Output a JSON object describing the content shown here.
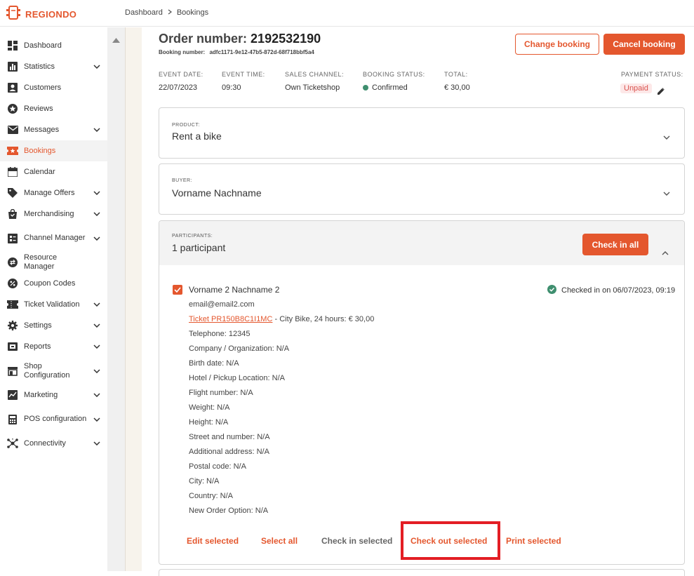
{
  "app": {
    "logo_text": "REGIONDO",
    "brand_color": "#e4572e"
  },
  "breadcrumb": {
    "items": [
      "Dashboard",
      "Bookings"
    ]
  },
  "sidebar": {
    "items": [
      {
        "label": "Dashboard",
        "icon": "dashboard-icon",
        "has_chevron": false
      },
      {
        "label": "Statistics",
        "icon": "chart-icon",
        "has_chevron": true
      },
      {
        "label": "Customers",
        "icon": "user-icon",
        "has_chevron": false
      },
      {
        "label": "Reviews",
        "icon": "star-icon",
        "has_chevron": false
      },
      {
        "label": "Messages",
        "icon": "mail-icon",
        "has_chevron": true
      },
      {
        "label": "Bookings",
        "icon": "ticket-icon",
        "has_chevron": false,
        "active": true
      },
      {
        "label": "Calendar",
        "icon": "calendar-icon",
        "has_chevron": false
      },
      {
        "label": "Manage Offers",
        "icon": "tag-icon",
        "has_chevron": true
      },
      {
        "label": "Merchandising",
        "icon": "bag-icon",
        "has_chevron": true
      },
      {
        "label": "Channel Manager",
        "icon": "channel-icon",
        "has_chevron": true
      },
      {
        "label": "Resource Manager",
        "icon": "swap-icon",
        "has_chevron": false
      },
      {
        "label": "Coupon Codes",
        "icon": "percent-icon",
        "has_chevron": false
      },
      {
        "label": "Ticket Validation",
        "icon": "ticket-validation-icon",
        "has_chevron": true
      },
      {
        "label": "Settings",
        "icon": "gear-icon",
        "has_chevron": true
      },
      {
        "label": "Reports",
        "icon": "wallet-icon",
        "has_chevron": true
      },
      {
        "label": "Shop Configuration",
        "icon": "shop-icon",
        "has_chevron": true
      },
      {
        "label": "Marketing",
        "icon": "marketing-icon",
        "has_chevron": true
      },
      {
        "label": "POS configuration",
        "icon": "calculator-icon",
        "has_chevron": true
      },
      {
        "label": "Connectivity",
        "icon": "network-icon",
        "has_chevron": true
      }
    ]
  },
  "order": {
    "title_label": "Order number:",
    "number": "2192532190",
    "booking_label": "Booking number:",
    "booking_number": "adfc1171-9e12-47b5-872d-68f718bbf5a4",
    "change_label": "Change booking",
    "cancel_label": "Cancel booking"
  },
  "meta": {
    "event_date_label": "EVENT DATE:",
    "event_date": "22/07/2023",
    "event_time_label": "EVENT TIME:",
    "event_time": "09:30",
    "sales_channel_label": "SALES CHANNEL:",
    "sales_channel": "Own Ticketshop",
    "booking_status_label": "BOOKING STATUS:",
    "booking_status": "Confirmed",
    "total_label": "TOTAL:",
    "total": "€ 30,00",
    "payment_status_label": "PAYMENT STATUS:",
    "payment_status": "Unpaid"
  },
  "product": {
    "label": "PRODUCT:",
    "value": "Rent a bike"
  },
  "buyer": {
    "label": "BUYER:",
    "value": "Vorname Nachname"
  },
  "participants": {
    "label": "PARTICIPANTS:",
    "value": "1 participant",
    "check_in_all": "Check in all",
    "participant": {
      "name": "Vorname 2 Nachname 2",
      "checked_in": "Checked in on 06/07/2023, 09:19",
      "email": "email@email2.com",
      "ticket_link": "Ticket PR150B8C1I1MC",
      "ticket_desc": " - City Bike, 24 hours: € 30,00",
      "details": [
        "Telephone: 12345",
        "Company / Organization: N/A",
        "Birth date: N/A",
        "Hotel / Pickup Location: N/A",
        "Flight number: N/A",
        "Weight: N/A",
        "Height: N/A",
        "Street and number: N/A",
        "Additional address: N/A",
        "Postal code: N/A",
        "City: N/A",
        "Country: N/A",
        "New Order Option: N/A"
      ]
    },
    "actions": {
      "edit": "Edit selected",
      "select_all": "Select all",
      "check_in": "Check in selected",
      "check_out": "Check out selected",
      "print": "Print selected"
    }
  }
}
